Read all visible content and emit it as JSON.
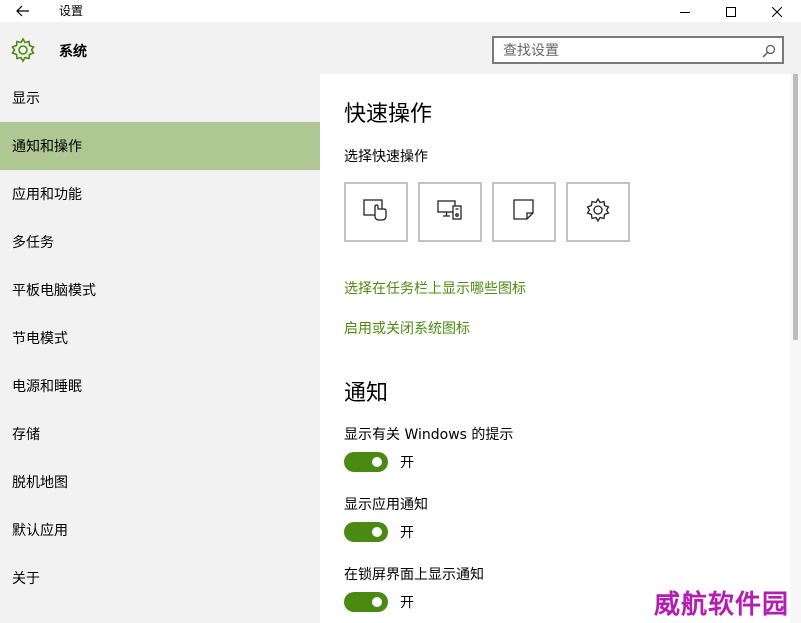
{
  "window": {
    "title": "设置",
    "back_icon": "back-arrow-icon",
    "controls": [
      "minimize-icon",
      "maximize-icon",
      "close-icon"
    ]
  },
  "header": {
    "icon": "gear-icon",
    "title": "系统",
    "search": {
      "placeholder": "查找设置",
      "icon": "search-icon"
    }
  },
  "sidebar": {
    "selected_index": 1,
    "selected_color": "#aec793",
    "items": [
      {
        "label": "显示"
      },
      {
        "label": "通知和操作"
      },
      {
        "label": "应用和功能"
      },
      {
        "label": "多任务"
      },
      {
        "label": "平板电脑模式"
      },
      {
        "label": "节电模式"
      },
      {
        "label": "电源和睡眠"
      },
      {
        "label": "存储"
      },
      {
        "label": "脱机地图"
      },
      {
        "label": "默认应用"
      },
      {
        "label": "关于"
      }
    ]
  },
  "main": {
    "quick_actions": {
      "heading": "快速操作",
      "subheading": "选择快速操作",
      "tiles": [
        {
          "icon": "tablet-mode-icon"
        },
        {
          "icon": "connect-icon"
        },
        {
          "icon": "note-icon"
        },
        {
          "icon": "settings-gear-icon"
        }
      ],
      "links": [
        "选择在任务栏上显示哪些图标",
        "启用或关闭系统图标"
      ],
      "link_color": "#4f8a10"
    },
    "notifications": {
      "heading": "通知",
      "toggle_color": "#4a8a12",
      "settings": [
        {
          "label": "显示有关 Windows 的提示",
          "state": "开"
        },
        {
          "label": "显示应用通知",
          "state": "开"
        },
        {
          "label": "在锁屏界面上显示通知",
          "state": "开"
        }
      ]
    }
  },
  "watermark": {
    "text": "威航软件园",
    "color": "#b41cb4"
  }
}
